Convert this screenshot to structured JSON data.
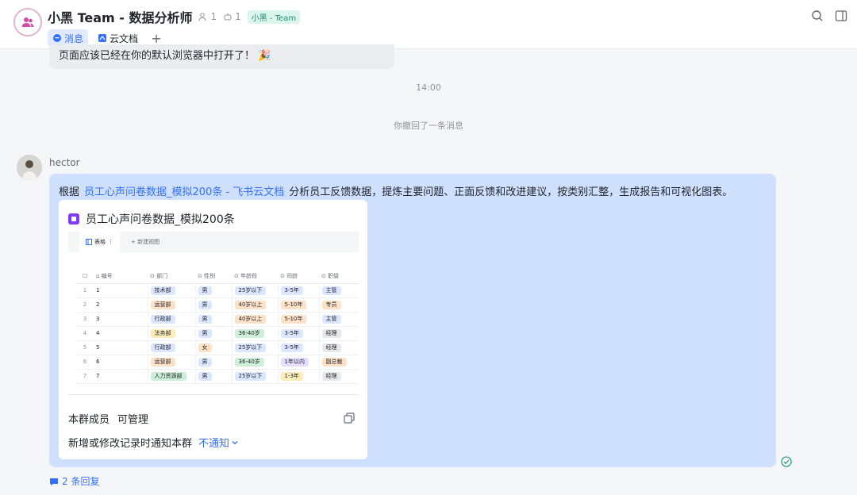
{
  "header": {
    "title": "小黑 Team - 数据分析师",
    "members_count": "1",
    "bots_count": "1",
    "tag": "小黑 - Team",
    "tabs": [
      {
        "label": "消息"
      },
      {
        "label": "云文档"
      }
    ],
    "add_tab": "+"
  },
  "chat": {
    "previous_message": "页面应该已经在你的默认浏览器中打开了！",
    "time_divider": "14:00",
    "recall_notice": "你撤回了一条消息",
    "message": {
      "sender": "hector",
      "text_prefix": "根据",
      "link_text": "员工心声问卷数据_模拟200条 - 飞书云文档",
      "text_suffix": "分析员工反馈数据，提炼主要问题、正面反馈和改进建议，按类别汇整，生成报告和可视化图表。",
      "card": {
        "title": "员工心声问卷数据_模拟200条",
        "preview": {
          "view_tab": "表格",
          "new_view": "新建视图",
          "columns": [
            "编号",
            "部门",
            "性别",
            "年龄段",
            "司龄",
            "职级"
          ],
          "rows": [
            {
              "idx": "1",
              "id": "1",
              "dept": "技术部",
              "gender": "男",
              "age": "25岁以下",
              "tenure": "3-5年",
              "level": "主管"
            },
            {
              "idx": "2",
              "id": "2",
              "dept": "运营部",
              "gender": "男",
              "age": "40岁以上",
              "tenure": "5-10年",
              "level": "专员"
            },
            {
              "idx": "3",
              "id": "3",
              "dept": "行政部",
              "gender": "男",
              "age": "40岁以上",
              "tenure": "5-10年",
              "level": "主管"
            },
            {
              "idx": "4",
              "id": "4",
              "dept": "法务部",
              "gender": "男",
              "age": "36-40岁",
              "tenure": "3-5年",
              "level": "经理"
            },
            {
              "idx": "5",
              "id": "5",
              "dept": "行政部",
              "gender": "女",
              "age": "25岁以下",
              "tenure": "3-5年",
              "level": "经理"
            },
            {
              "idx": "6",
              "id": "6",
              "dept": "运营部",
              "gender": "男",
              "age": "36-40岁",
              "tenure": "1年以内",
              "level": "副总裁"
            },
            {
              "idx": "7",
              "id": "7",
              "dept": "人力资源部",
              "gender": "男",
              "age": "25岁以下",
              "tenure": "1-3年",
              "level": "经理"
            }
          ]
        },
        "members_label": "本群成员",
        "members_permission": "可管理",
        "notify_label": "新增或修改记录时通知本群",
        "notify_value": "不通知"
      }
    },
    "replies": "2 条回复"
  }
}
